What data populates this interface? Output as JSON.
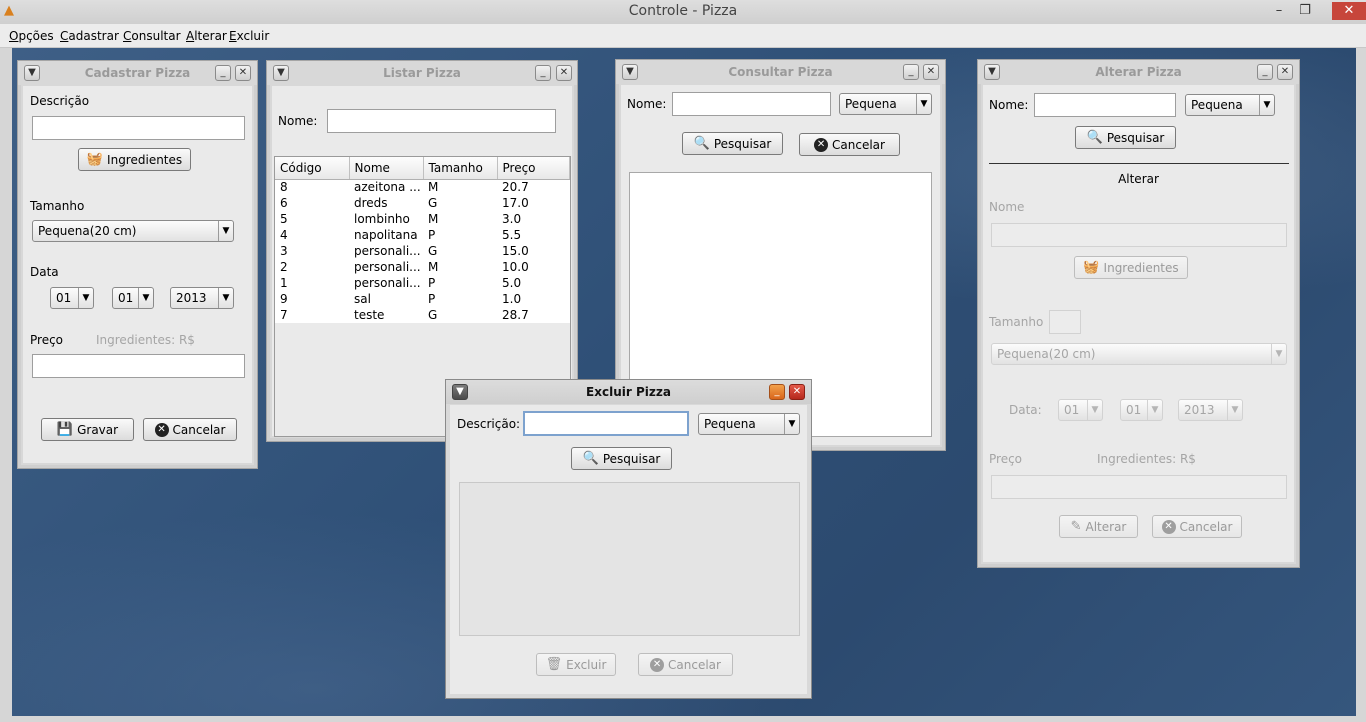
{
  "window": {
    "title": "Controle - Pizza",
    "minimize": "–",
    "restore": "❐",
    "close": "✕"
  },
  "menu": [
    "Opções",
    "Cadastrar",
    "Consultar",
    "Alterar",
    "Excluir"
  ],
  "cadastrar": {
    "title": "Cadastrar Pizza",
    "descricao_label": "Descrição",
    "ingredientes_btn": "Ingredientes",
    "tamanho_label": "Tamanho",
    "tamanho_value": "Pequena(20 cm)",
    "data_label": "Data",
    "day": "01",
    "month": "01",
    "year": "2013",
    "preco_label": "Preço",
    "ingredientes_price": "Ingredientes: R$",
    "gravar_btn": "Gravar",
    "cancelar_btn": "Cancelar"
  },
  "listar": {
    "title": "Listar Pizza",
    "nome_label": "Nome:",
    "columns": [
      "Código",
      "Nome",
      "Tamanho",
      "Preço"
    ],
    "rows": [
      [
        "8",
        "azeitona ...",
        "M",
        "20.7"
      ],
      [
        "6",
        "dreds",
        "G",
        "17.0"
      ],
      [
        "5",
        "lombinho",
        "M",
        "3.0"
      ],
      [
        "4",
        "napolitana",
        "P",
        "5.5"
      ],
      [
        "3",
        "personali...",
        "G",
        "15.0"
      ],
      [
        "2",
        "personali...",
        "M",
        "10.0"
      ],
      [
        "1",
        "personali...",
        "P",
        "5.0"
      ],
      [
        "9",
        "sal",
        "P",
        "1.0"
      ],
      [
        "7",
        "teste",
        "G",
        "28.7"
      ]
    ]
  },
  "consultar": {
    "title": "Consultar Pizza",
    "nome_label": "Nome:",
    "tamanho_value": "Pequena",
    "pesquisar_btn": "Pesquisar",
    "cancelar_btn": "Cancelar"
  },
  "alterar": {
    "title": "Alterar Pizza",
    "nome_label": "Nome:",
    "tamanho_value": "Pequena",
    "pesquisar_btn": "Pesquisar",
    "section_title": "Alterar",
    "nome2_label": "Nome",
    "ingredientes_btn": "Ingredientes",
    "tamanho_label": "Tamanho",
    "tamanho2_value": "Pequena(20 cm)",
    "data_label": "Data:",
    "day": "01",
    "month": "01",
    "year": "2013",
    "preco_label": "Preço",
    "ingredientes_price": "Ingredientes: R$",
    "alterar_btn": "Alterar",
    "cancelar_btn": "Cancelar"
  },
  "excluir": {
    "title": "Excluir Pizza",
    "descricao_label": "Descrição:",
    "tamanho_value": "Pequena",
    "pesquisar_btn": "Pesquisar",
    "excluir_btn": "Excluir",
    "cancelar_btn": "Cancelar"
  }
}
